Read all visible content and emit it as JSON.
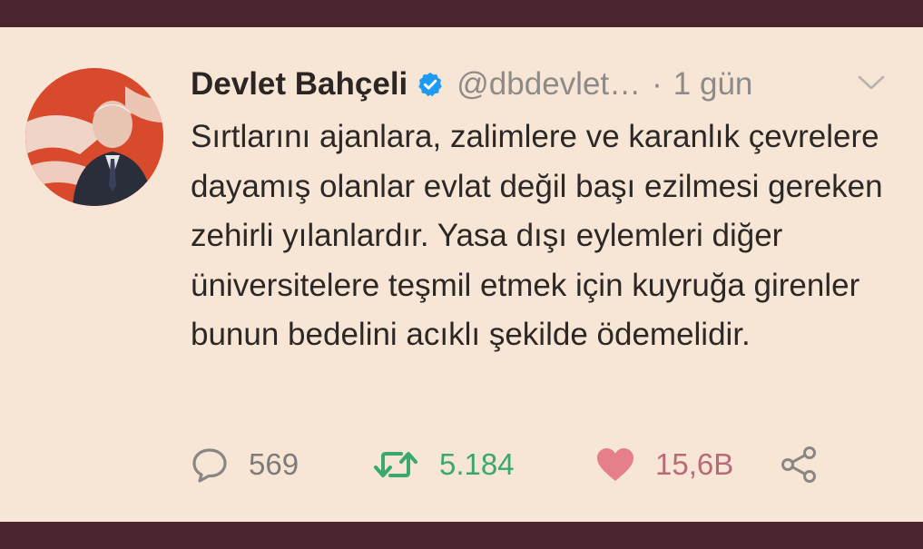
{
  "tweet": {
    "author_name": "Devlet Bahçeli",
    "handle": "@dbdevlet…",
    "separator": "·",
    "time": "1 gün",
    "text": "Sırtlarını ajanlara, zalimlere ve karanlık çevrelere dayamış olanlar evlat değil başı ezilmesi gereken zehirli yılanlardır. Yasa dışı eylemleri diğer üniversitelere teşmil etmek için kuyruğa girenler bunun bedelini acıklı şekilde ödemelidir.",
    "reply_count": "569",
    "retweet_count": "5.184",
    "like_count": "15,6B"
  },
  "icons": {
    "verified": "verified-badge-icon",
    "chevron": "chevron-down-icon",
    "reply": "reply-bubble-icon",
    "retweet": "retweet-icon",
    "like": "heart-icon",
    "share": "share-icon"
  },
  "colors": {
    "background": "#f7e6d6",
    "frame": "#4a2530",
    "verified": "#1d9bf0",
    "retweet": "#3aa96b",
    "like": "#e57f8a",
    "muted": "#8d8a88"
  }
}
